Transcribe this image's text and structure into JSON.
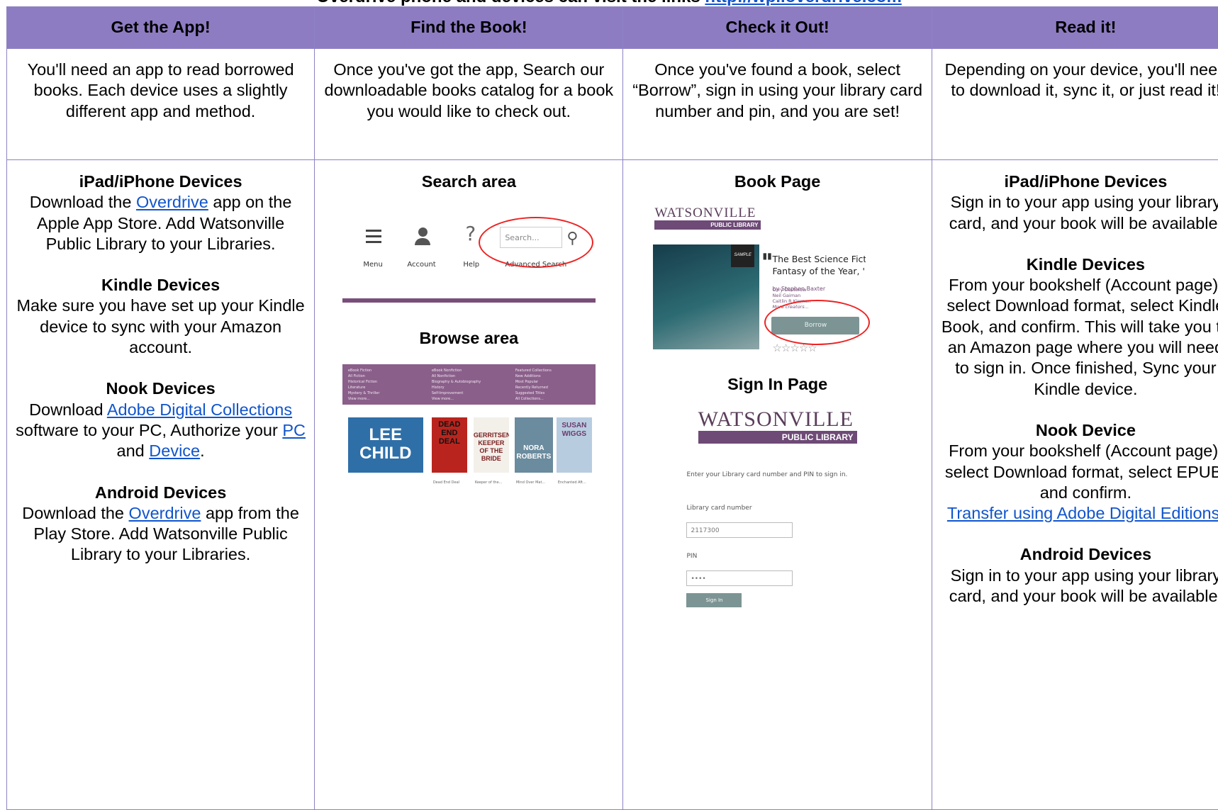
{
  "intro_line": {
    "text": "Overdrive phone and devices can visit the links ",
    "link": "http://wpl.overdrive.com"
  },
  "columns": [
    {
      "header": "Get the App!",
      "intro": "You'll need an app to read borrowed books. Each device uses a slightly different app and method."
    },
    {
      "header": "Find the Book!",
      "intro": "Once you've got the app, Search our downloadable books catalog for a book you would like to check out."
    },
    {
      "header": "Check it Out!",
      "intro": "Once you've found a book, select “Borrow”, sign in using your library card number and pin, and you are set!"
    },
    {
      "header": "Read it!",
      "intro": "Depending on your device, you'll need to download it, sync it, or just read it!"
    }
  ],
  "get_app": {
    "ipad": {
      "title": "iPad/iPhone Devices",
      "pre": "Download the ",
      "link": "Overdrive",
      "post": " app on the Apple App Store. Add Watsonville Public Library to your Libraries."
    },
    "kindle": {
      "title": "Kindle Devices",
      "text": "Make sure you have set up your Kindle device to sync with your Amazon account."
    },
    "nook": {
      "title": "Nook Devices",
      "pre": "Download ",
      "link1": "Adobe Digital Collections",
      "mid1": " software to your PC, Authorize your ",
      "link2": "PC",
      "mid2": " and ",
      "link3": "Device",
      "post": "."
    },
    "android": {
      "title": "Android Devices",
      "pre": "Download the ",
      "link": "Overdrive",
      "post": " app from the Play Store. Add Watsonville Public Library to your Libraries."
    }
  },
  "find_book": {
    "search_title": "Search area",
    "browse_title": "Browse area",
    "search_shot": {
      "menu": "Menu",
      "account": "Account",
      "help": "Help",
      "placeholder": "Search...",
      "advanced": "Advanced Search"
    },
    "browse_shot": {
      "col1": [
        "eBook Fiction",
        "All Fiction",
        "Historical Fiction",
        "Literature",
        "Mystery & Thriller",
        "View more..."
      ],
      "col2": [
        "eBook Nonfiction",
        "All Nonfiction",
        "Biography & Autobiography",
        "History",
        "Self-Improvement",
        "View more..."
      ],
      "col3": [
        "Featured Collections",
        "New Additions",
        "Most Popular",
        "Recently Returned",
        "Suggested Titles",
        "All Collections..."
      ],
      "new_additions": "New Additions",
      "view_more": "View more...",
      "covers": [
        {
          "title": "LEE CHILD",
          "color": "#2f6fa8",
          "caption": ""
        },
        {
          "title": "DEAD END DEAL",
          "color": "#b9251e",
          "caption": "Dead End Deal"
        },
        {
          "title": "GERRITSEN KEEPER OF THE BRIDE",
          "color": "#f3f0ea",
          "caption": "Keeper of the..."
        },
        {
          "title": "NORA ROBERTS",
          "color": "#6b8b9e",
          "caption": "Mind Over Mat..."
        },
        {
          "title": "SUSAN WIGGS",
          "color": "#b8cce0",
          "caption": "Enchanted Aft..."
        }
      ]
    }
  },
  "check_out": {
    "book_title": "Book Page",
    "signin_title": "Sign In Page",
    "logo_word": "WATSONVILLE",
    "logo_bar": "PUBLIC LIBRARY",
    "book": {
      "sample": "SAMPLE",
      "title_line1": "The Best Science Fict",
      "title_line2": "Fantasy of the Year, '",
      "by": "by Stephen Baxter",
      "creators": [
        "Cory Doctorow",
        "Neil Gaiman",
        "Caitlin R Kiernan",
        "More creators..."
      ],
      "borrow": "Borrow",
      "stars": "☆☆☆☆☆"
    },
    "form": {
      "note": "Enter your Library card number and PIN to sign in.",
      "card_label": "Library card number",
      "card_value": "2117300",
      "pin_label": "PIN",
      "pin_value": "••••",
      "button": "Sign In"
    }
  },
  "read_it": {
    "ipad": {
      "title": "iPad/iPhone Devices",
      "text": "Sign in to your app using your library card, and your book will be available."
    },
    "kindle": {
      "title": "Kindle Devices",
      "text": "From your bookshelf (Account page), select Download format, select Kindle Book, and confirm. This will take you to an Amazon page where you will need to sign in. Once finished, Sync your Kindle device."
    },
    "nook": {
      "title": "Nook Device",
      "text": "From your bookshelf (Account page), select Download format, select EPUB, and confirm.",
      "link": "Transfer using Adobe Digital Editions",
      "post": "."
    },
    "android": {
      "title": "Android Devices",
      "text": "Sign in to your app using your library card, and your book will be available."
    }
  },
  "colors": {
    "header_bg": "#8e7cc3",
    "border": "#8d82c3",
    "link": "#1155cc",
    "annotation_ring": "#ee2222"
  }
}
